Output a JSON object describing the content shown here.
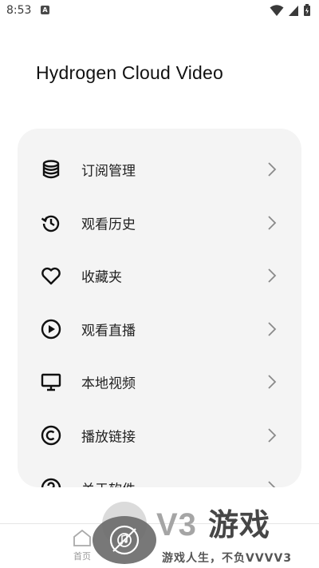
{
  "status_bar": {
    "time": "8:53",
    "notification_badge": "A"
  },
  "app": {
    "title": "Hydrogen Cloud Video"
  },
  "menu": {
    "items": [
      {
        "label": "订阅管理",
        "icon": "database-icon"
      },
      {
        "label": "观看历史",
        "icon": "history-icon"
      },
      {
        "label": "收藏夹",
        "icon": "heart-icon"
      },
      {
        "label": "观看直播",
        "icon": "play-circle-icon"
      },
      {
        "label": "本地视频",
        "icon": "monitor-icon"
      },
      {
        "label": "播放链接",
        "icon": "copyright-icon"
      },
      {
        "label": "关于软件",
        "icon": "help-icon"
      }
    ]
  },
  "bottom_nav": {
    "home_label": "首页"
  },
  "watermark": {
    "logo": "V3",
    "logo_cn": "游戏",
    "tagline": "游戏人生，不负VVVV3"
  },
  "colors": {
    "card_bg": "#f4f4f4",
    "text": "#222222",
    "chevron": "#8a8a8a"
  }
}
